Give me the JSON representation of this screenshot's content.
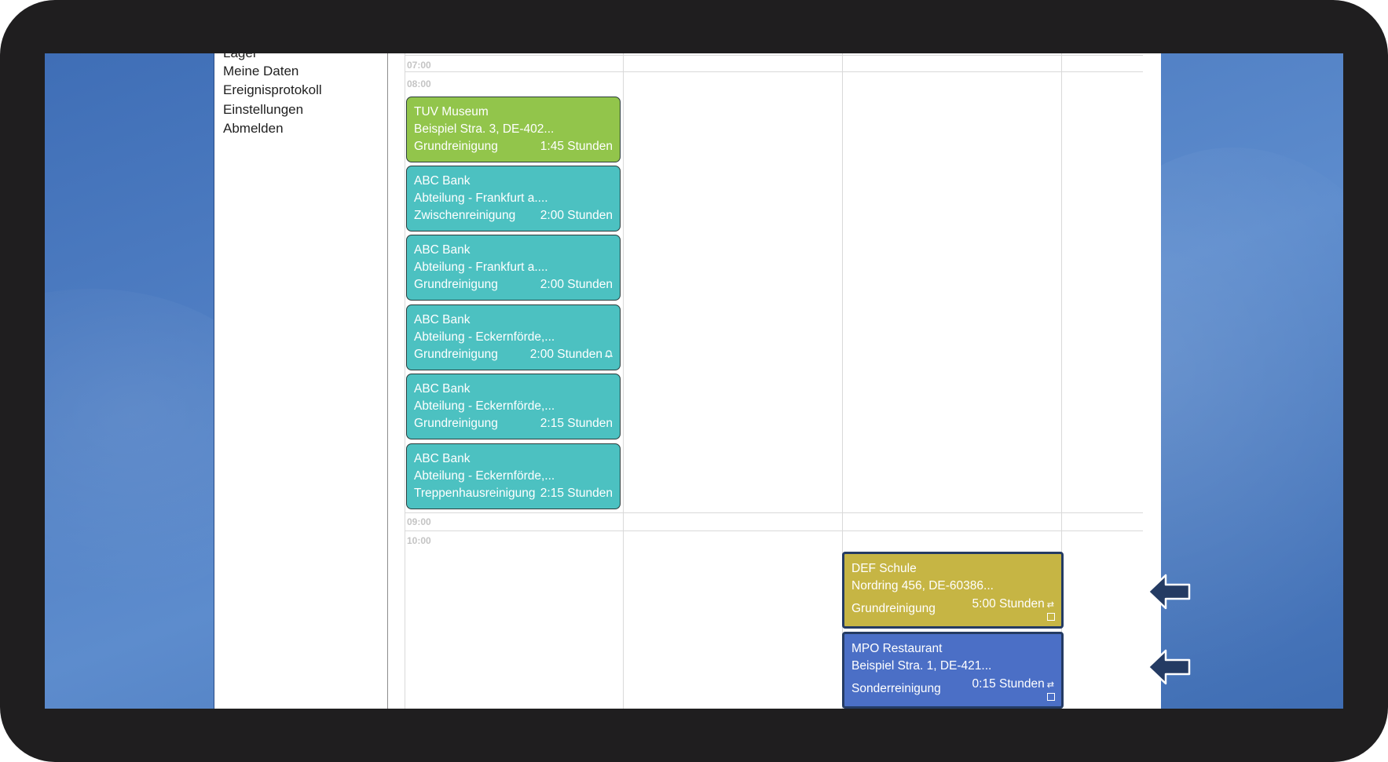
{
  "sidebar": {
    "items": [
      {
        "label": "Lager"
      },
      {
        "label": "Meine Daten"
      },
      {
        "label": "Ereignisprotokoll"
      },
      {
        "label": "Einstellungen"
      },
      {
        "label": "Abmelden"
      }
    ]
  },
  "calendar": {
    "time_labels": [
      "07:00",
      "08:00",
      "09:00",
      "10:00"
    ],
    "events": [
      {
        "title": "TUV Museum",
        "address": "Beispiel Stra. 3, DE-402...",
        "service": "Grundreinigung",
        "duration": "1:45 Stunden",
        "color": "#92c54b"
      },
      {
        "title": "ABC Bank",
        "address": "Abteilung - Frankfurt a....",
        "service": "Zwischenreinigung",
        "duration": "2:00 Stunden",
        "color": "#4cc1c1"
      },
      {
        "title": "ABC Bank",
        "address": "Abteilung - Frankfurt a....",
        "service": "Grundreinigung",
        "duration": "2:00 Stunden",
        "color": "#4cc1c1"
      },
      {
        "title": "ABC Bank",
        "address": "Abteilung - Eckernförde,...",
        "service": "Grundreinigung",
        "duration": "2:00 Stunden",
        "color": "#4cc1c1",
        "icon": "bell-icon"
      },
      {
        "title": "ABC Bank",
        "address": "Abteilung - Eckernförde,...",
        "service": "Grundreinigung",
        "duration": "2:15 Stunden",
        "color": "#4cc1c1"
      },
      {
        "title": "ABC Bank",
        "address": "Abteilung - Eckernförde,...",
        "service": "Treppenhausreinigung",
        "duration": "2:15 Stunden",
        "color": "#4cc1c1"
      },
      {
        "title": "DEF Schule",
        "address": "Nordring 456, DE-60386...",
        "service": "Grundreinigung",
        "duration": "5:00 Stunden",
        "color": "#c6b544",
        "icon": "swap-icon",
        "selected": true
      },
      {
        "title": "MPO Restaurant",
        "address": "Beispiel Stra. 1, DE-421...",
        "service": "Sonderreinigung",
        "duration": "0:15 Stunden",
        "color": "#4b6fc6",
        "icon": "swap-icon",
        "selected": true
      }
    ]
  },
  "icons": {
    "bell": "bell-icon",
    "swap": "swap-icon",
    "checkbox": "checkbox-icon",
    "pointer_arrow": "left-arrow-icon"
  },
  "colors": {
    "frame": "#1f1e1f",
    "desktop": "#4f7ec3",
    "green_event": "#92c54b",
    "teal_event": "#4cc1c1",
    "olive_event": "#c6b544",
    "blue_event": "#4b6fc6",
    "arrow": "#243b63"
  }
}
